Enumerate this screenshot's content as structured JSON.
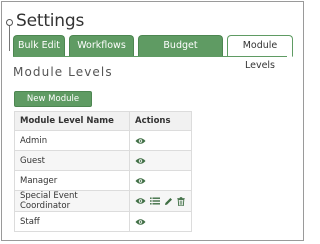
{
  "page": {
    "title": "Settings"
  },
  "tabs": [
    {
      "label": "Bulk Edit",
      "active": false
    },
    {
      "label": "Workflows",
      "active": false
    },
    {
      "label": "Budget Approvers",
      "active": false
    },
    {
      "label": "Module Levels",
      "active": true
    }
  ],
  "section": {
    "title": "Module Levels",
    "new_button_label": "New Module Level"
  },
  "table": {
    "headers": [
      "Module Level Name",
      "Actions"
    ],
    "rows": [
      {
        "name": "Admin",
        "actions": [
          "view-icon"
        ]
      },
      {
        "name": "Guest",
        "actions": [
          "view-icon"
        ]
      },
      {
        "name": "Manager",
        "actions": [
          "view-icon"
        ]
      },
      {
        "name": "Special Event Coordinator",
        "actions": [
          "view-icon",
          "list-icon",
          "edit-icon",
          "delete-icon"
        ]
      },
      {
        "name": "Staff",
        "actions": [
          "view-icon"
        ]
      }
    ]
  },
  "colors": {
    "accent": "#5f9b63",
    "icon": "#3f6e44"
  }
}
